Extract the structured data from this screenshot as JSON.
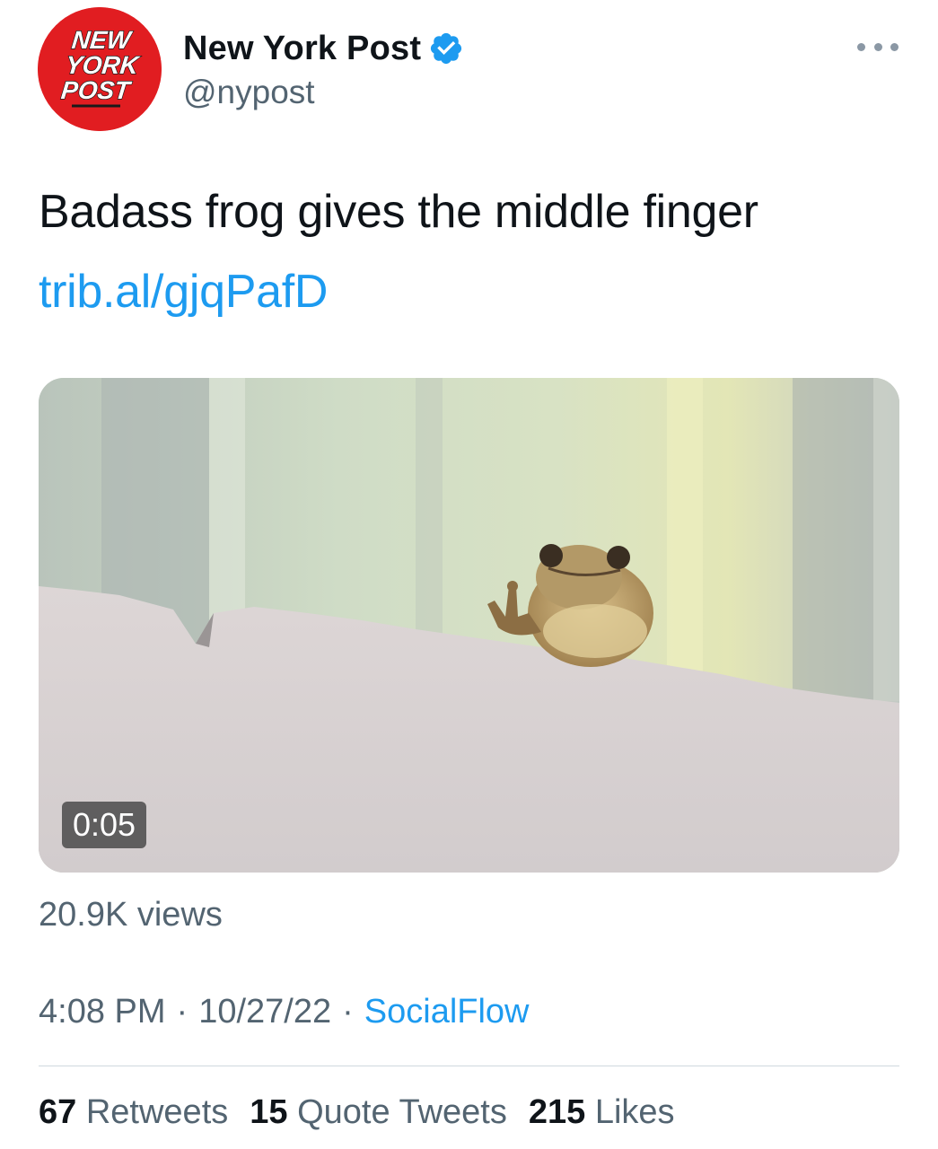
{
  "author": {
    "display_name": "New York Post",
    "handle": "@nypost",
    "verified": true,
    "avatar_logo_text": [
      "NEW",
      "YORK",
      "POST"
    ],
    "avatar_color": "#e11d21"
  },
  "menu": {
    "icon": "more-horizontal-icon"
  },
  "tweet": {
    "text": "Badass frog gives the middle finger",
    "link": "trib.al/gjqPafD"
  },
  "media": {
    "type": "video",
    "description_icon": "video-thumbnail",
    "duration": "0:05"
  },
  "views": "20.9K views",
  "meta": {
    "time": "4:08 PM",
    "date": "10/27/22",
    "source": "SocialFlow",
    "separator": "·"
  },
  "stats": {
    "retweets": {
      "count": "67",
      "label": "Retweets"
    },
    "quotes": {
      "count": "15",
      "label": "Quote Tweets"
    },
    "likes": {
      "count": "215",
      "label": "Likes"
    }
  },
  "colors": {
    "link": "#1d9bf0",
    "secondary_text": "#536471",
    "primary_text": "#0f1419"
  }
}
